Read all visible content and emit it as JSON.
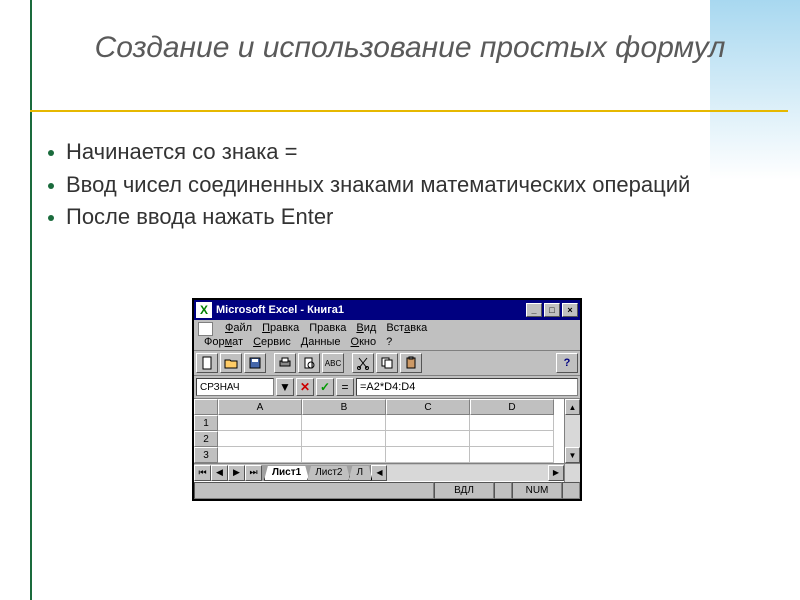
{
  "slide": {
    "title": "Создание и использование простых формул",
    "bullets": [
      "Начинается со знака =",
      "Ввод чисел соединенных знаками математических операций",
      "После ввода нажать Enter"
    ]
  },
  "excel": {
    "titlebar": "Microsoft Excel - Книга1",
    "app_glyph": "X",
    "menus": {
      "file": "Файл",
      "edit1": "Правка",
      "edit2": "Правка",
      "view": "Вид",
      "insert": "Вставка",
      "format": "Формат",
      "tools": "Сервис",
      "data": "Данные",
      "window": "Окно",
      "help": "?"
    },
    "formula": {
      "namebox": "СРЗНАЧ",
      "equals": "=",
      "input": "=A2*D4:D4"
    },
    "columns": [
      "A",
      "B",
      "C",
      "D"
    ],
    "rows": [
      "1",
      "2",
      "3"
    ],
    "tabs": {
      "sheet1": "Лист1",
      "sheet2": "Лист2",
      "sheet3_cut": "Л"
    },
    "status": {
      "left": "",
      "mode": "ВДЛ",
      "num": "NUM"
    },
    "win_controls": {
      "min": "_",
      "max": "□",
      "close": "×"
    }
  }
}
